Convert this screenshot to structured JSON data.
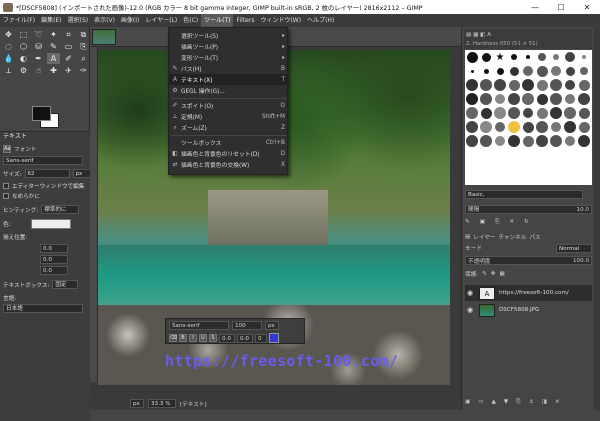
{
  "window": {
    "title": "*[DSCF5808] (インポートされた画像)-12.0 (RGB カラー 8 bit gamma integer, GIMP built-in sRGB, 2 枚のレイヤー) 2816x2112 – GIMP",
    "buttons": [
      "—",
      "☐",
      "✕"
    ]
  },
  "menubar": [
    "ファイル(F)",
    "編集(E)",
    "選択(S)",
    "表示(V)",
    "画像(I)",
    "レイヤー(L)",
    "色(C)",
    "ツール(T)",
    "Filters",
    "ウィンドウ(W)",
    "ヘルプ(H)"
  ],
  "tools_menu": {
    "items": [
      {
        "label": "選択ツール(S)",
        "icon": "",
        "shortcut": "▸"
      },
      {
        "label": "描画ツール(P)",
        "icon": "",
        "shortcut": "▸"
      },
      {
        "label": "変形ツール(T)",
        "icon": "",
        "shortcut": "▸"
      },
      {
        "label": "パス(H)",
        "icon": "✎",
        "shortcut": "B"
      },
      {
        "label": "テキスト(X)",
        "icon": "A",
        "shortcut": "T"
      },
      {
        "label": "GEGL 操作(G)...",
        "icon": "⚙",
        "shortcut": ""
      },
      {
        "label": "スポイト(O)",
        "icon": "✐",
        "shortcut": "O"
      },
      {
        "label": "定規(M)",
        "icon": "⟂",
        "shortcut": "Shift+M"
      },
      {
        "label": "ズーム(Z)",
        "icon": "⌕",
        "shortcut": "Z"
      },
      {
        "label": "ツールボックス",
        "icon": "",
        "shortcut": "Ctrl+B"
      },
      {
        "label": "描画色と背景色のリセット(D)",
        "icon": "◧",
        "shortcut": "D"
      },
      {
        "label": "描画色と背景色の交換(W)",
        "icon": "⇄",
        "shortcut": "X"
      }
    ]
  },
  "tool_options": {
    "header": "テキスト",
    "font_label": "フォント",
    "font_value": "Sans-serif",
    "size_label": "サイズ:",
    "size_value": "62",
    "size_unit": "px",
    "use_editor": "エディターウィンドウで編集",
    "antialias": "なめらかに",
    "hinting_label": "ヒンティング:",
    "hinting_value": "標準的に",
    "color_label": "色:",
    "justify_label": "揃え位置:",
    "box_label": "テキストボックス:",
    "box_value": "固定",
    "language_label": "言語:",
    "language_value": "日本語",
    "zero": "0.0"
  },
  "canvas": {
    "watermark_text": "https://freesoft-100.com/",
    "text_toolbar_font": "Sans-serif",
    "text_toolbar_size": "100",
    "text_toolbar_unit": "px",
    "text_toolbar_values": [
      "0.0",
      "0.0",
      "0"
    ],
    "text_color": "#3333dd"
  },
  "statusbar": {
    "unit": "px",
    "zoom": "33.3 %",
    "status": "[テキスト]"
  },
  "right_dock": {
    "brush_title": "2. Hardness 050 (51 × 51)",
    "brush_filter": "Basic,",
    "spacing_label": "間隔",
    "spacing_value": "10.0",
    "tabs": [
      "レイヤー",
      "チャンネル",
      "パス"
    ],
    "mode_label": "モード",
    "mode_value": "Normal",
    "opacity_label": "不透明度",
    "opacity_value": "100.0",
    "lock_label": "保護:",
    "layers": [
      {
        "name": "https://freesoft-100.com/",
        "selected": true
      },
      {
        "name": "DSCF5808.JPG",
        "selected": false
      }
    ]
  }
}
